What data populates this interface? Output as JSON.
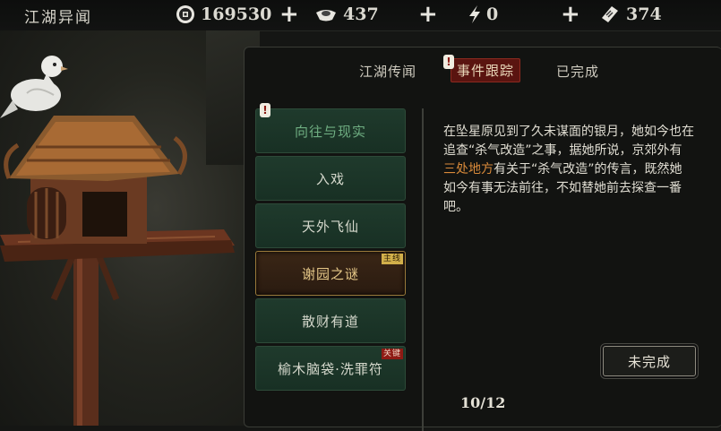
{
  "topbar": {
    "title": "江湖异闻",
    "coins": "169530",
    "silver": "437",
    "energy": "0",
    "tickets": "374",
    "plus": "+"
  },
  "tabs": [
    {
      "label": "江湖传闻",
      "active": false
    },
    {
      "label": "事件跟踪",
      "active": true
    },
    {
      "label": "已完成",
      "active": false
    }
  ],
  "quests": [
    {
      "label": "向往与现实",
      "badge": null,
      "alert": true
    },
    {
      "label": "入戏",
      "badge": null
    },
    {
      "label": "天外飞仙",
      "badge": null
    },
    {
      "label": "谢园之谜",
      "badge": "主线",
      "selected": true
    },
    {
      "label": "散财有道",
      "badge": null
    },
    {
      "label": "榆木脑袋·洗罪符",
      "badge": "关键"
    }
  ],
  "description": {
    "part1": "在坠星原见到了久未谋面的银月，她如今也在追查“杀气改造”之事，据她所说，京郊外有",
    "highlight": "三处地方",
    "part2": "有关于“杀气改造”的传言，既然她如今有事无法前往，不如替她前去探查一番吧。"
  },
  "status_button": "未完成",
  "page": "10/12",
  "colors": {
    "accent_red": "#5a1410",
    "quest_green": "#1f3a2c",
    "highlight": "#d98a3a"
  },
  "icons": [
    "coin-icon",
    "silver-ingot-icon",
    "lightning-icon",
    "ticket-icon",
    "alert-icon"
  ]
}
